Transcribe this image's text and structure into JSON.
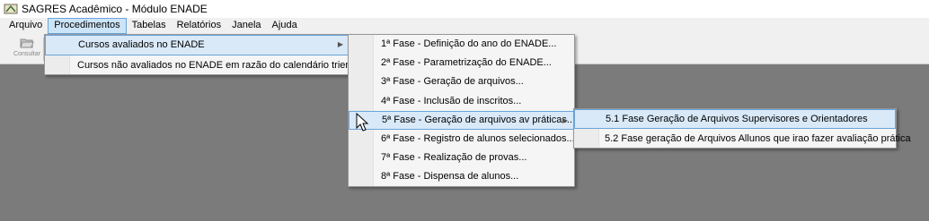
{
  "window": {
    "title": "SAGRES Acadêmico - Módulo ENADE"
  },
  "menubar": {
    "items": [
      {
        "label": "Arquivo"
      },
      {
        "label": "Procedimentos"
      },
      {
        "label": "Tabelas"
      },
      {
        "label": "Relatórios"
      },
      {
        "label": "Janela"
      },
      {
        "label": "Ajuda"
      }
    ]
  },
  "toolbar": {
    "consultar_label": "Consultar"
  },
  "procedimentos_menu": {
    "items": [
      {
        "label": "Cursos avaliados no ENADE"
      },
      {
        "label": "Cursos não avaliados no ENADE em razão do calendário trienal..."
      }
    ]
  },
  "fases_menu": {
    "items": [
      {
        "label": "1ª Fase - Definição do ano do ENADE..."
      },
      {
        "label": "2ª Fase - Parametrização do ENADE..."
      },
      {
        "label": "3ª Fase - Geração de arquivos..."
      },
      {
        "label": "4ª Fase - Inclusão de inscritos..."
      },
      {
        "label": "5ª Fase - Geração de arquivos av práticas..."
      },
      {
        "label": "6ª Fase - Registro de alunos selecionados..."
      },
      {
        "label": "7ª Fase - Realização de provas..."
      },
      {
        "label": "8ª Fase - Dispensa de alunos..."
      }
    ]
  },
  "quinta_fase_menu": {
    "items": [
      {
        "label": "5.1 Fase Geração de Arquivos Supervisores e Orientadores"
      },
      {
        "label": "5.2 Fase geração de Arquivos Allunos que irao fazer avaliação prática"
      }
    ]
  },
  "colors": {
    "highlight_bg": "#d9e9f8",
    "highlight_border": "#6aa4d8",
    "workspace": "#7b7b7b"
  }
}
